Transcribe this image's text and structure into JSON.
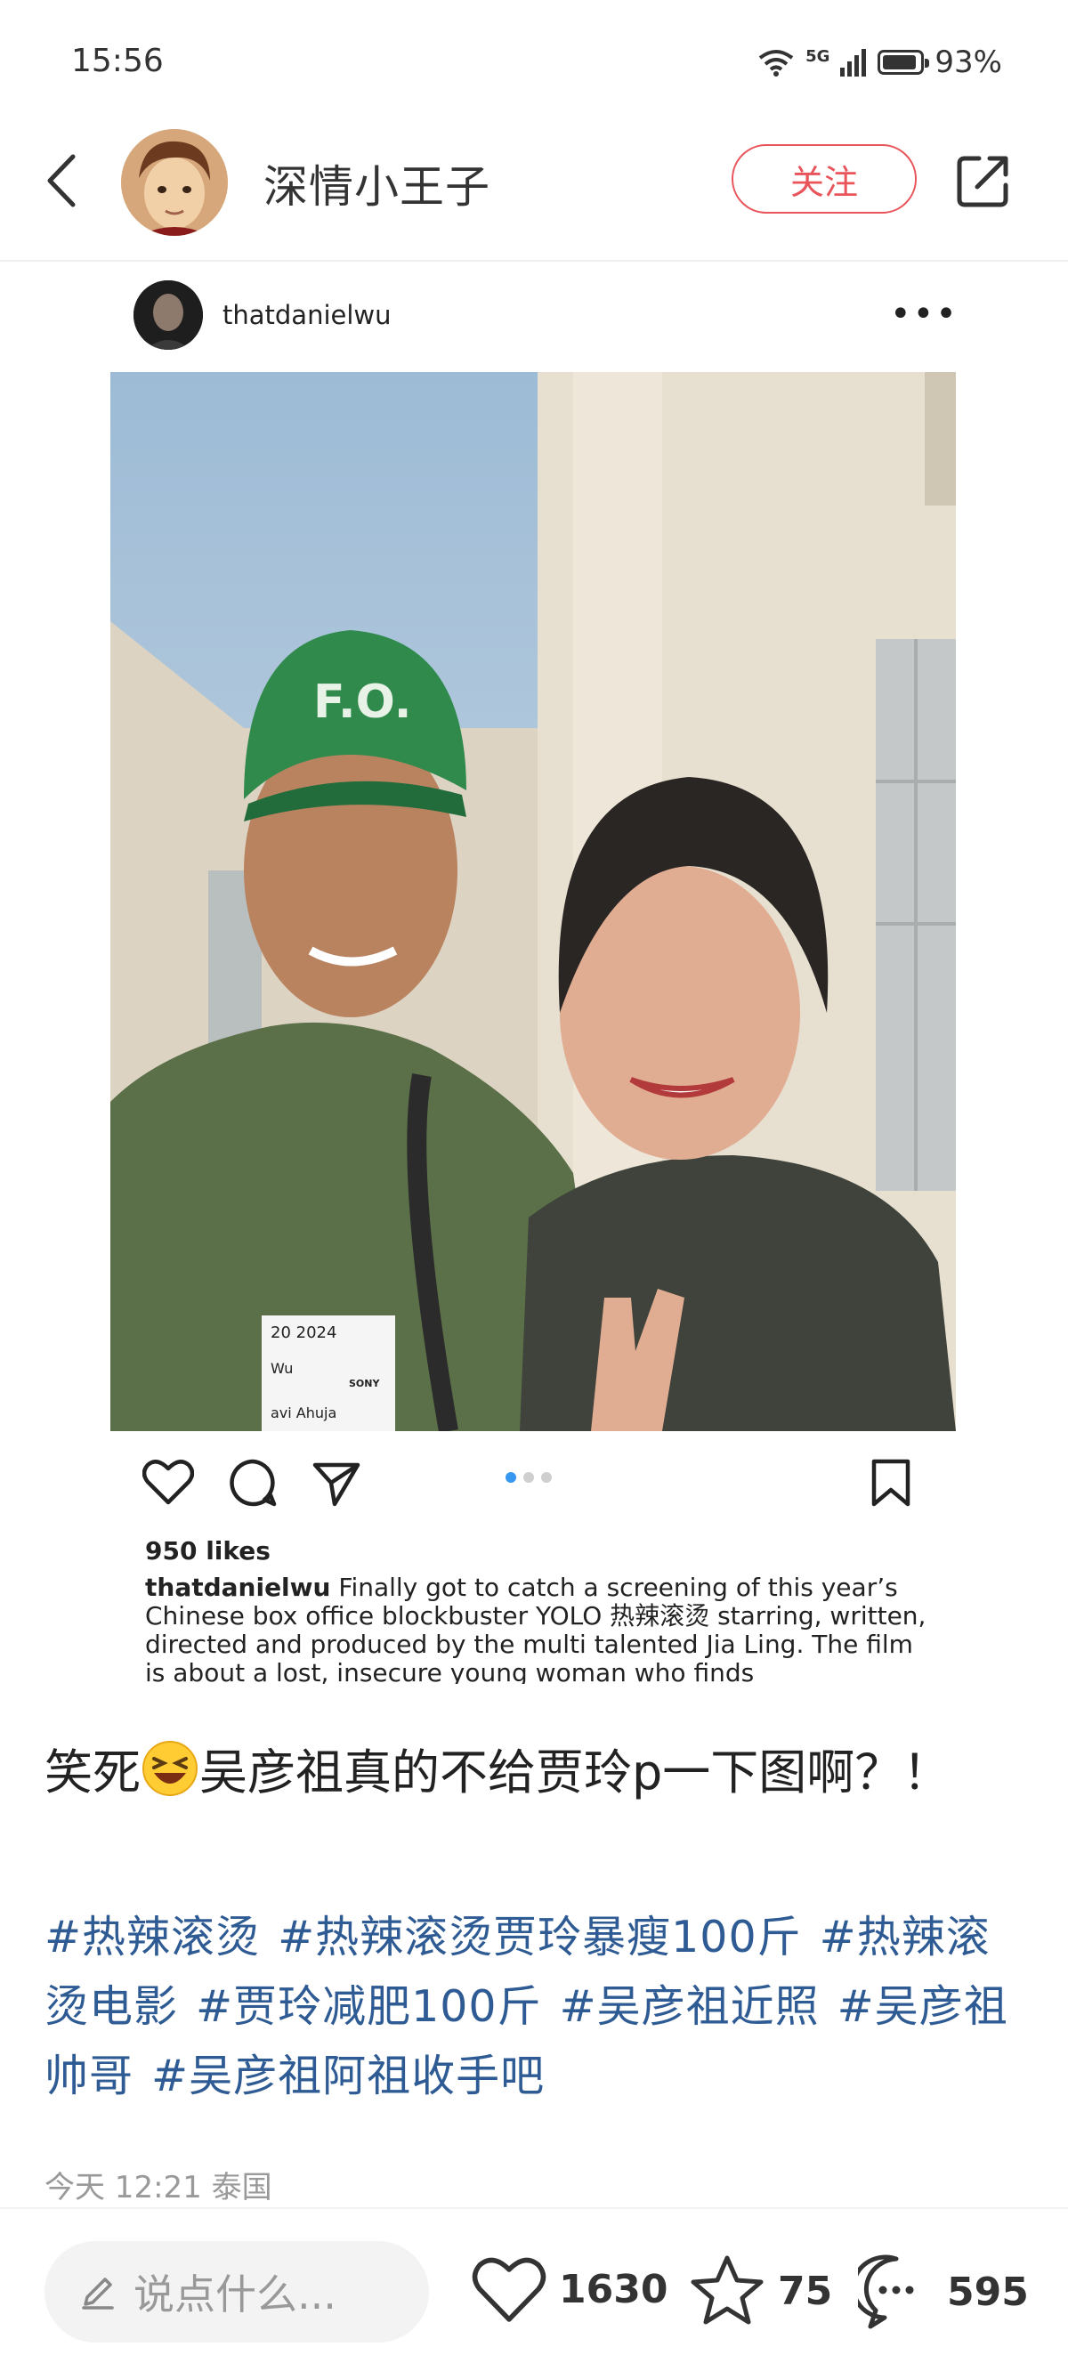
{
  "status_bar": {
    "time": "15:56",
    "network": "5G",
    "battery": "93%",
    "battery_level": 0.93
  },
  "header": {
    "username": "深情小王子",
    "follow_label": "关注"
  },
  "embed": {
    "ig_username": "thatdanielwu",
    "more_label": "•••",
    "badge_text": [
      "20 2024",
      "Wu",
      "avi Ahuja",
      "SONY"
    ],
    "likes": "950 likes",
    "caption_user": "thatdanielwu",
    "caption_text": "Finally got to catch a screening of this year’s Chinese box office blockbuster YOLO 热辣滚烫 starring, written, directed and produced by the multi talented Jia Ling. The film is about a lost, insecure young woman who finds"
  },
  "post": {
    "title_before": "笑死",
    "title_after": "吴彦祖真的不给贾玲p一下图啊？！",
    "hashtags": [
      "#热辣滚烫",
      "#热辣滚烫贾玲暴瘦100斤",
      "#热辣滚烫电影",
      "#贾玲减肥100斤",
      "#吴彦祖近照",
      "#吴彦祖帅哥",
      "#吴彦祖阿祖收手吧"
    ],
    "time": "今天 12:21",
    "location": "泰国"
  },
  "bottom_bar": {
    "comment_placeholder": "说点什么...",
    "likes": "1630",
    "favorites": "75",
    "comments": "595"
  },
  "colors": {
    "follow": "#e8545a",
    "hashtag": "#2e5b93",
    "ig_dot_active": "#3897f0"
  }
}
